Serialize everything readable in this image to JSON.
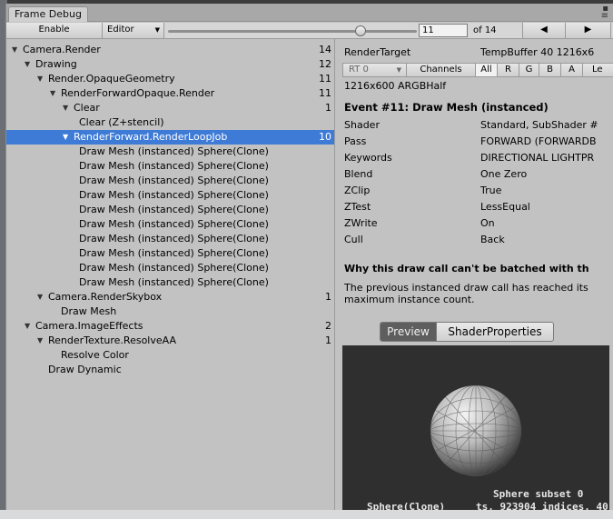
{
  "window": {
    "tab_title": "Frame Debug"
  },
  "toolbar": {
    "enable_label": "Enable",
    "target_label": "Editor",
    "event_index": "11",
    "event_total": "of 14",
    "slider_fraction": 0.7857
  },
  "tree": {
    "rows": [
      {
        "label": "Camera.Render",
        "count": "14",
        "depth": 0,
        "expanded": true
      },
      {
        "label": "Drawing",
        "count": "12",
        "depth": 1,
        "expanded": true
      },
      {
        "label": "Render.OpaqueGeometry",
        "count": "11",
        "depth": 2,
        "expanded": true
      },
      {
        "label": "RenderForwardOpaque.Render",
        "count": "11",
        "depth": 3,
        "expanded": true
      },
      {
        "label": "Clear",
        "count": "1",
        "depth": 4,
        "expanded": true
      },
      {
        "label": "Clear (Z+stencil)",
        "count": "",
        "depth": 5,
        "expanded": false
      },
      {
        "label": "RenderForward.RenderLoopJob",
        "count": "10",
        "depth": 4,
        "expanded": true,
        "selected": true
      },
      {
        "label": "Draw Mesh (instanced) Sphere(Clone)",
        "count": "",
        "depth": 5
      },
      {
        "label": "Draw Mesh (instanced) Sphere(Clone)",
        "count": "",
        "depth": 5
      },
      {
        "label": "Draw Mesh (instanced) Sphere(Clone)",
        "count": "",
        "depth": 5
      },
      {
        "label": "Draw Mesh (instanced) Sphere(Clone)",
        "count": "",
        "depth": 5
      },
      {
        "label": "Draw Mesh (instanced) Sphere(Clone)",
        "count": "",
        "depth": 5
      },
      {
        "label": "Draw Mesh (instanced) Sphere(Clone)",
        "count": "",
        "depth": 5
      },
      {
        "label": "Draw Mesh (instanced) Sphere(Clone)",
        "count": "",
        "depth": 5
      },
      {
        "label": "Draw Mesh (instanced) Sphere(Clone)",
        "count": "",
        "depth": 5
      },
      {
        "label": "Draw Mesh (instanced) Sphere(Clone)",
        "count": "",
        "depth": 5
      },
      {
        "label": "Draw Mesh (instanced) Sphere(Clone)",
        "count": "",
        "depth": 5
      },
      {
        "label": "Camera.RenderSkybox",
        "count": "1",
        "depth": 2,
        "expanded": true
      },
      {
        "label": "Draw Mesh",
        "count": "",
        "depth": 3
      },
      {
        "label": "Camera.ImageEffects",
        "count": "2",
        "depth": 1,
        "expanded": true
      },
      {
        "label": "RenderTexture.ResolveAA",
        "count": "1",
        "depth": 2,
        "expanded": true
      },
      {
        "label": "Resolve Color",
        "count": "",
        "depth": 3
      },
      {
        "label": "Draw Dynamic",
        "count": "",
        "depth": 2
      }
    ]
  },
  "details": {
    "render_target_label": "RenderTarget",
    "render_target_value": "TempBuffer 40 1216x6",
    "rt_dropdown": "RT 0",
    "channels_label": "Channels",
    "channels": [
      "All",
      "R",
      "G",
      "B",
      "A",
      "Le"
    ],
    "resolution": "1216x600 ARGBHalf",
    "event_title": "Event #11: Draw Mesh (instanced)",
    "props": [
      {
        "key": "Shader",
        "value": "Standard, SubShader #"
      },
      {
        "key": "Pass",
        "value": "FORWARD (FORWARDB"
      },
      {
        "key": "Keywords",
        "value": "DIRECTIONAL LIGHTPR"
      },
      {
        "key": "Blend",
        "value": "One Zero"
      },
      {
        "key": "ZClip",
        "value": "True"
      },
      {
        "key": "ZTest",
        "value": "LessEqual"
      },
      {
        "key": "ZWrite",
        "value": "On"
      },
      {
        "key": "Cull",
        "value": "Back"
      }
    ],
    "batch_heading": "Why this draw call can't be batched with th",
    "batch_reason_1": "The previous instanced draw call has reached its",
    "batch_reason_2": "maximum instance count.",
    "preview_tab": "Preview",
    "shader_props_tab": "ShaderProperties",
    "preview_subset": "Sphere subset 0",
    "preview_name": "Sphere(Clone)",
    "preview_stats": "ts, 923904 indices, 40"
  },
  "colors": {
    "selection": "#3e7bd6",
    "panel": "#c2c2c2",
    "preview_bg": "#2f2f2f"
  }
}
